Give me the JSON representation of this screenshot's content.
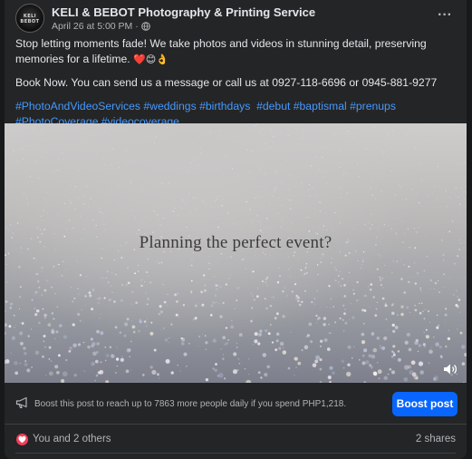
{
  "post": {
    "page_name": "KELI & BEBOT Photography & Printing Service",
    "avatar_text": "KELI BEBOT",
    "date": "April 26 at 5:00 PM",
    "separator": "·",
    "more": "···",
    "text_line1": "Stop letting moments fade! We take photos and videos in stunning detail, preserving memories for a lifetime.",
    "text_line1_emoji": "❤️😊👌",
    "text_line2": "Book Now. You can send us a message or call us at 0927-118-6696 or 0945-881-9277",
    "hashtags": [
      "#PhotoAndVideoServices",
      "#weddings",
      "#birthdays",
      "#debut",
      "#baptismal",
      "#prenups",
      "#PhotoCoverage",
      "#videocoverage"
    ]
  },
  "media": {
    "caption": "Planning the perfect event?"
  },
  "boost": {
    "text": "Boost this post to reach up to 7863 more people daily if you spend PHP1,218.",
    "button_label": "Boost post"
  },
  "engagement": {
    "reactions_text": "You and 2 others",
    "shares_text": "2 shares"
  },
  "colors": {
    "background": "#18191a",
    "card": "#242526",
    "link": "#4599ff",
    "primary_button": "#0866ff",
    "heart": "#f33e58"
  }
}
